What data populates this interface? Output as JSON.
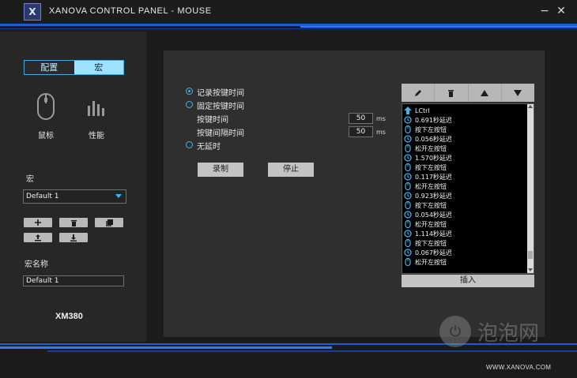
{
  "window": {
    "logo_text": "X",
    "title": "XANOVA CONTROL PANEL - MOUSE",
    "minimize_glyph": "−",
    "close_glyph": "✕"
  },
  "tabs": [
    {
      "label": "配置",
      "active": false
    },
    {
      "label": "宏",
      "active": true
    }
  ],
  "nav": {
    "mouse_label": "鼠标",
    "performance_label": "性能"
  },
  "macro": {
    "section_label": "宏",
    "selected": "Default 1",
    "name_label": "宏名称",
    "name_value": "Default 1"
  },
  "device": {
    "model": "XM380"
  },
  "record_options": {
    "record_key_time": "记录按键时间",
    "fixed_key_time": "固定按键时间",
    "key_time_label": "按键时间",
    "key_time_value": "50",
    "key_interval_label": "按键间隔时间",
    "key_interval_value": "50",
    "unit": "ms",
    "no_delay": "无延时",
    "selected": "record_key_time"
  },
  "actions": {
    "record": "录制",
    "stop": "停止",
    "insert": "插入"
  },
  "macro_list": [
    {
      "icon": "arrow-up-icon",
      "text": "LCtrl"
    },
    {
      "icon": "clock-icon",
      "text": "0.691秒延迟"
    },
    {
      "icon": "mouse-icon",
      "text": "按下左按钮"
    },
    {
      "icon": "clock-icon",
      "text": "0.056秒延迟"
    },
    {
      "icon": "mouse-icon",
      "text": "松开左按钮"
    },
    {
      "icon": "clock-icon",
      "text": "1.570秒延迟"
    },
    {
      "icon": "mouse-icon",
      "text": "按下左按钮"
    },
    {
      "icon": "clock-icon",
      "text": "0.117秒延迟"
    },
    {
      "icon": "mouse-icon",
      "text": "松开左按钮"
    },
    {
      "icon": "clock-icon",
      "text": "0.923秒延迟"
    },
    {
      "icon": "mouse-icon",
      "text": "按下左按钮"
    },
    {
      "icon": "clock-icon",
      "text": "0.054秒延迟"
    },
    {
      "icon": "mouse-icon",
      "text": "松开左按钮"
    },
    {
      "icon": "clock-icon",
      "text": "1.114秒延迟"
    },
    {
      "icon": "mouse-icon",
      "text": "按下左按钮"
    },
    {
      "icon": "clock-icon",
      "text": "0.067秒延迟"
    },
    {
      "icon": "mouse-icon",
      "text": "松开左按钮"
    }
  ],
  "watermark": {
    "text": "泡泡网"
  },
  "footer": {
    "url": "WWW.XANOVA.COM"
  },
  "colors": {
    "accent": "#3fb6e8",
    "stripe_blue": "#1e5bd6",
    "panel": "#2f2f2f",
    "sidebar": "#272727"
  }
}
